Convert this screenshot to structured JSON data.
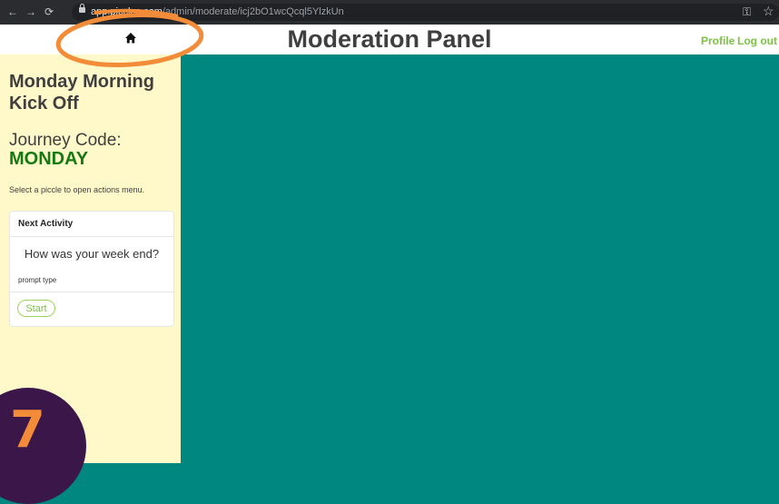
{
  "browser": {
    "url_host": "app.piccles.com",
    "url_path": "/admin/moderate/icj2bO1wcQcql5YlzkUn",
    "back_icon": "arrow-left-icon",
    "forward_icon": "arrow-right-icon",
    "reload_icon": "reload-icon",
    "key_icon": "key-icon",
    "star_icon": "star-icon"
  },
  "header": {
    "title": "Moderation Panel",
    "home_icon": "home-icon",
    "links": {
      "profile": "Profile",
      "logout": "Log out"
    }
  },
  "sidebar": {
    "title": "Monday Morning Kick Off",
    "journey_code_label": "Journey Code:",
    "journey_code": "MONDAY",
    "hint": "Select a piccle to open actions menu.",
    "next_activity": {
      "title": "Next Activity",
      "question": "How was your week end?",
      "type": "prompt type",
      "start_label": "Start"
    }
  },
  "overlay": {
    "step_number": "7"
  },
  "colors": {
    "accent_green": "#7cc242",
    "journey_code_green": "#147a14",
    "main_teal": "#00877f",
    "sidebar_yellow": "#fff8c8",
    "annotation_orange": "#f28c38",
    "badge_purple": "#3a1748"
  }
}
